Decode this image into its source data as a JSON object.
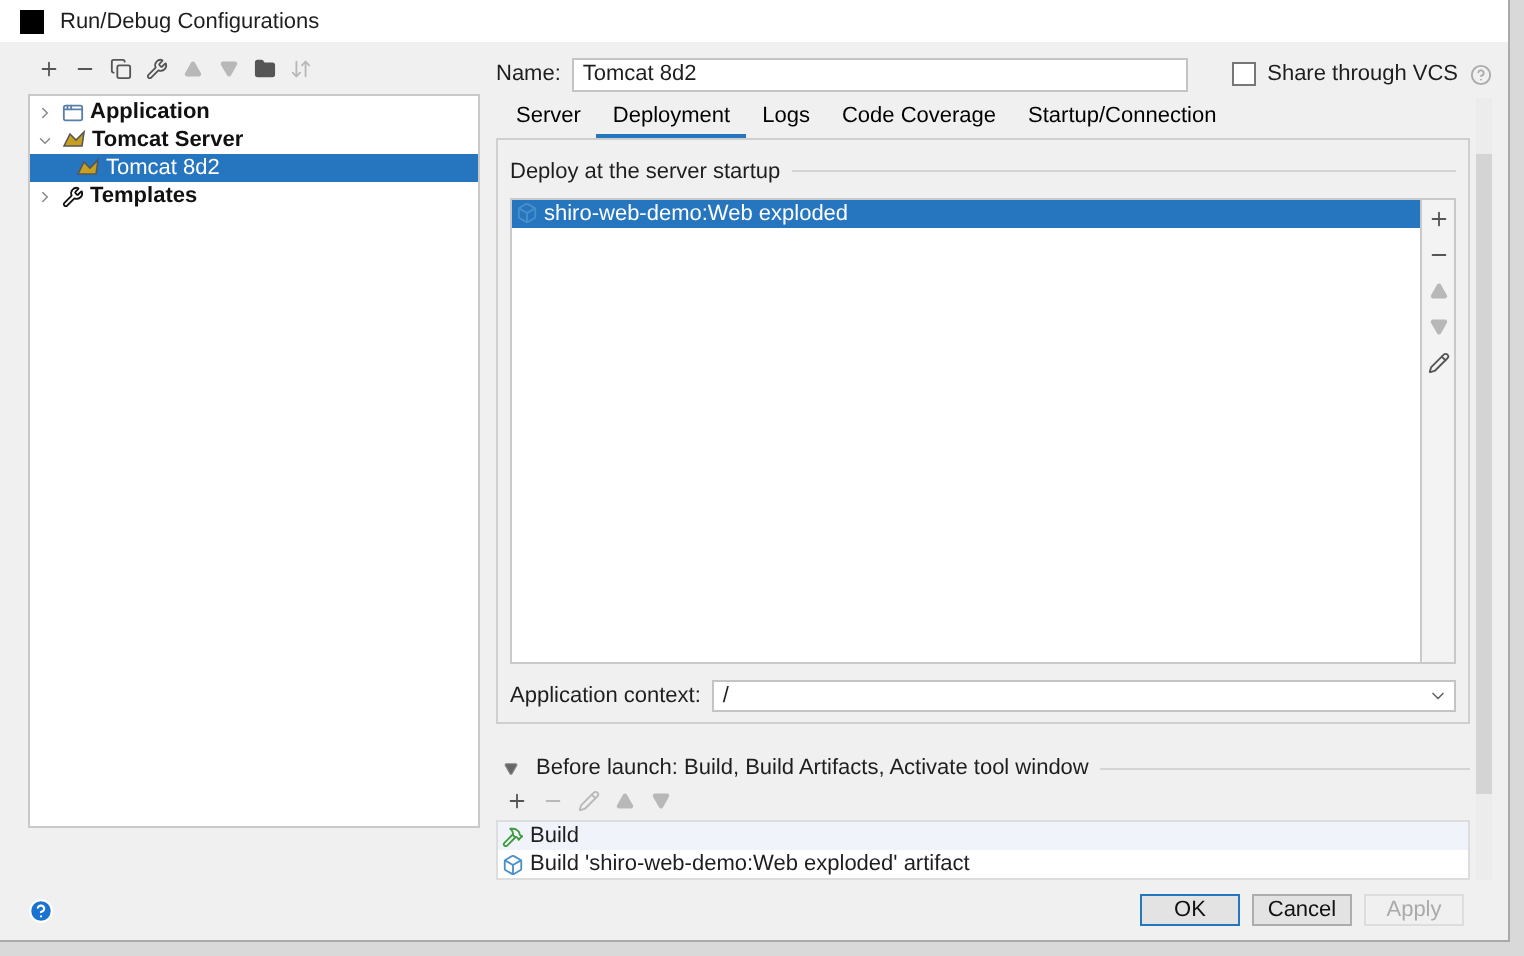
{
  "window": {
    "title": "Run/Debug Configurations"
  },
  "toolbar": [
    {
      "kind": "add",
      "disabled": false
    },
    {
      "kind": "remove",
      "disabled": false
    },
    {
      "kind": "copy",
      "disabled": false
    },
    {
      "kind": "wrench",
      "disabled": false
    },
    {
      "kind": "up",
      "disabled": true
    },
    {
      "kind": "down",
      "disabled": true
    },
    {
      "kind": "folder",
      "disabled": false
    },
    {
      "kind": "sort",
      "disabled": true
    }
  ],
  "tree": [
    {
      "label": "Application",
      "kind": "application",
      "expanded": false,
      "selected": false
    },
    {
      "label": "Tomcat Server",
      "kind": "tomcat",
      "expanded": true,
      "selected": false,
      "children": [
        {
          "label": "Tomcat 8d2",
          "kind": "tomcat",
          "selected": true
        }
      ]
    },
    {
      "label": "Templates",
      "kind": "wrench",
      "expanded": false,
      "selected": false
    }
  ],
  "name": {
    "label": "Name:",
    "value": "Tomcat 8d2"
  },
  "share": {
    "label": "Share through VCS",
    "checked": false
  },
  "tabs": [
    {
      "label": "Server",
      "selected": false
    },
    {
      "label": "Deployment",
      "selected": true
    },
    {
      "label": "Logs",
      "selected": false
    },
    {
      "label": "Code Coverage",
      "selected": false
    },
    {
      "label": "Startup/Connection",
      "selected": false
    }
  ],
  "deploy": {
    "title": "Deploy at the server startup",
    "items": [
      {
        "label": "shiro-web-demo:Web exploded",
        "selected": true
      }
    ],
    "tools": [
      {
        "kind": "add",
        "disabled": false
      },
      {
        "kind": "remove",
        "disabled": false
      },
      {
        "kind": "up",
        "disabled": true
      },
      {
        "kind": "down",
        "disabled": true
      },
      {
        "kind": "edit",
        "disabled": false
      }
    ]
  },
  "context": {
    "label": "Application context:",
    "value": "/"
  },
  "before_launch": {
    "title": "Before launch: Build, Build Artifacts, Activate tool window",
    "expanded": true,
    "tools": [
      {
        "kind": "add",
        "disabled": false
      },
      {
        "kind": "remove",
        "disabled": true
      },
      {
        "kind": "edit",
        "disabled": true
      },
      {
        "kind": "up",
        "disabled": true
      },
      {
        "kind": "down",
        "disabled": true
      }
    ],
    "tasks": [
      {
        "label": "Build",
        "kind": "build",
        "selected": true
      },
      {
        "label": "Build 'shiro-web-demo:Web exploded' artifact",
        "kind": "artifact",
        "selected": false
      }
    ]
  },
  "buttons": [
    {
      "label": "OK",
      "kind": "default",
      "disabled": false
    },
    {
      "label": "Cancel",
      "kind": "normal",
      "disabled": false
    },
    {
      "label": "Apply",
      "kind": "normal",
      "disabled": true
    }
  ]
}
